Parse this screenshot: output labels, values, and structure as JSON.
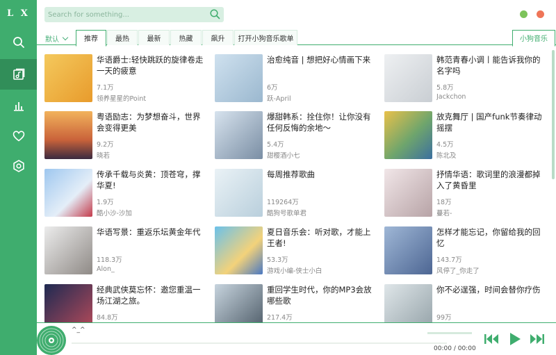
{
  "app": {
    "logo": "L X"
  },
  "sidebar": {
    "items": [
      {
        "name": "search-icon",
        "active": false
      },
      {
        "name": "music-library-icon",
        "active": true
      },
      {
        "name": "chart-icon",
        "active": false
      },
      {
        "name": "heart-icon",
        "active": false
      },
      {
        "name": "gear-icon",
        "active": false
      }
    ]
  },
  "search": {
    "placeholder": "Search for something..."
  },
  "tabs": {
    "sort_label": "默认",
    "items": [
      "推荐",
      "最热",
      "最新",
      "热藏",
      "飙升",
      "打开小狗音乐歌单"
    ],
    "active_index": 0,
    "source": "小狗音乐"
  },
  "playlists": [
    {
      "title": "华语爵士:轻快跳跃的旋律卷走一天的疲意",
      "count": "7.1万",
      "author": "领养星星的Point"
    },
    {
      "title": "治愈纯音 | 想把好心情画下来",
      "count": "6万",
      "author": "跃-April"
    },
    {
      "title": "韩范青春小调丨能告诉我你的名字吗",
      "count": "5.8万",
      "author": "Jackchon"
    },
    {
      "title": "粤语励志：为梦想奋斗，世界会变得更美",
      "count": "9.2万",
      "author": "晓若"
    },
    {
      "title": "爆甜韩系：拴住你！让你没有任何反悔的余地～",
      "count": "5.4万",
      "author": "甜樱酒小七"
    },
    {
      "title": "放克舞厅 | 国产funk节奏律动摇摆",
      "count": "4.5万",
      "author": "陈北及"
    },
    {
      "title": "传承千载与炎黄：顶苍穹，撑华夏!",
      "count": "1.9万",
      "author": "酷小沙-沙加"
    },
    {
      "title": "每周推荐歌曲",
      "count": "119264万",
      "author": "酷狗号歌单君"
    },
    {
      "title": "抒情华语：歌词里的浪漫都掉入了黄昏里",
      "count": "18万",
      "author": "蔓若-"
    },
    {
      "title": "华语写景：重返乐坛黄金年代",
      "count": "118.3万",
      "author": "Alon_"
    },
    {
      "title": "夏日音乐会：听对歌，才能上王者!",
      "count": "53.3万",
      "author": "游戏小编-侠士小白"
    },
    {
      "title": "怎样才能忘记，你留给我的回忆",
      "count": "143.7万",
      "author": "风停了_你走了"
    },
    {
      "title": "经典武侠莫忘怀：邀您重温一场江湖之旅。",
      "count": "84.8万",
      "author": ""
    },
    {
      "title": "重回学生时代，你的MP3会放哪些歌",
      "count": "217.4万",
      "author": ""
    },
    {
      "title": "你不必逞强，时间会替你疗伤",
      "count": "99万",
      "author": ""
    }
  ],
  "player": {
    "song": "^_^",
    "current_time": "00:00",
    "separator": "/",
    "total_time": "00:00"
  },
  "colors": {
    "accent": "#3fad6e",
    "accent_dark": "#318e59",
    "min": "#7cc35a",
    "close": "#ef7558"
  }
}
